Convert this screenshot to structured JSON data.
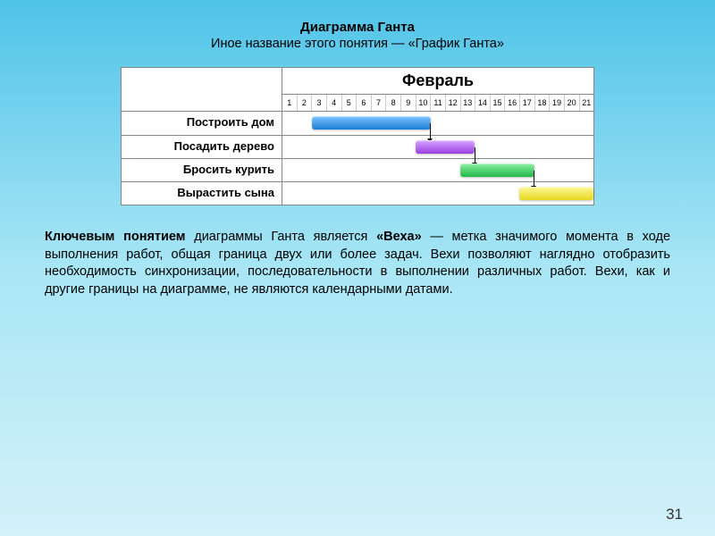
{
  "title": "Диаграмма Ганта",
  "subtitle": "Иное название этого понятия — «График Ганта»",
  "description_html": "<span class='lead'><b>Ключевым понятием</b> диаграммы Ганта является <b>«Веха»</b> — метка значимого момента в ходе выполнения работ, общая граница двух или более задач. Вехи позволяют наглядно отобразить необходимость синхронизации, последовательности в выполнении различных работ.  Вехи, как и другие границы на диаграмме, не являются календарными датами.</span>",
  "page_number": "31",
  "chart_data": {
    "type": "bar",
    "orientation": "gantt",
    "month_label": "Февраль",
    "days": [
      1,
      2,
      3,
      4,
      5,
      6,
      7,
      8,
      9,
      10,
      11,
      12,
      13,
      14,
      15,
      16,
      17,
      18,
      19,
      20,
      21
    ],
    "xlim": [
      1,
      21
    ],
    "tasks": [
      {
        "label": "Построить дом",
        "start": 3,
        "end": 10,
        "color": "#1a7fd6",
        "css": "bar-blue"
      },
      {
        "label": "Посадить дерево",
        "start": 10,
        "end": 13,
        "color": "#9a3fe0",
        "css": "bar-purple"
      },
      {
        "label": "Бросить курить",
        "start": 13,
        "end": 17,
        "color": "#22b84a",
        "css": "bar-green"
      },
      {
        "label": "Вырастить сына",
        "start": 17,
        "end": 21,
        "color": "#e6d820",
        "css": "bar-yellow"
      }
    ],
    "dependencies": [
      {
        "from": 0,
        "to": 1
      },
      {
        "from": 1,
        "to": 2
      },
      {
        "from": 2,
        "to": 3
      }
    ]
  }
}
